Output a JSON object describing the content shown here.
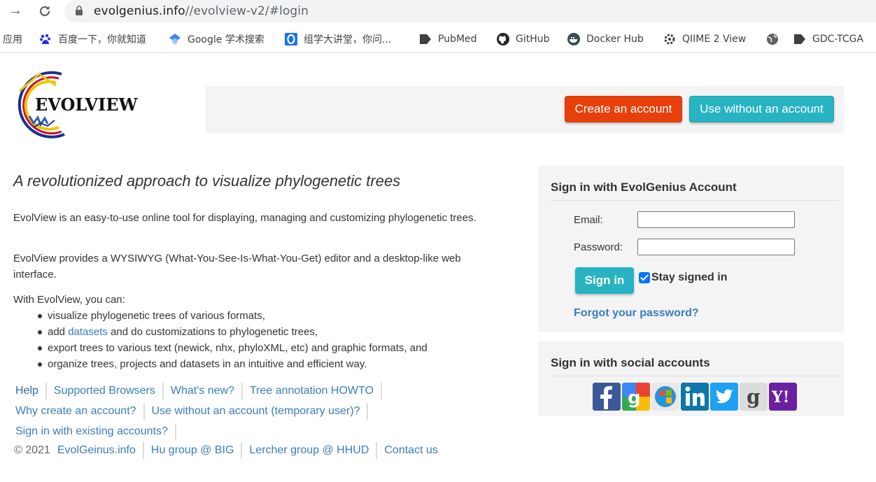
{
  "browser": {
    "url_host": "evolgenius.info",
    "url_path": "//evolview-v2/#login",
    "bookmarks": [
      {
        "label": "应用",
        "icon": "apps-icon"
      },
      {
        "label": "百度一下，你就知道",
        "icon": "baidu-icon"
      },
      {
        "label": "Google 学术搜索",
        "icon": "google-scholar-icon"
      },
      {
        "label": "组学大讲堂，你问...",
        "icon": "omics-icon"
      },
      {
        "label": "PubMed",
        "icon": "pubmed-icon"
      },
      {
        "label": "GitHub",
        "icon": "github-icon"
      },
      {
        "label": "Docker Hub",
        "icon": "docker-icon"
      },
      {
        "label": "QIIME 2 View",
        "icon": "qiime-icon"
      },
      {
        "label": "",
        "icon": "globe-icon"
      },
      {
        "label": "GDC-TCGA",
        "icon": "gdc-icon"
      }
    ]
  },
  "header": {
    "logo_text": "EVOLVIEW",
    "create_label": "Create an account",
    "without_label": "Use without an account"
  },
  "main": {
    "tagline": "A revolutionized approach to visualize phylogenetic trees",
    "para1": "EvolView is an easy-to-use online tool for displaying, managing and customizing phylogenetic trees.",
    "para2": "EvolView provides a WYSIWYG (What-You-See-Is-What-You-Get) editor and a desktop-like web interface.",
    "para3": "With EvolView, you can:",
    "list": [
      "visualize phylogenetic trees of various formats,",
      "add",
      "export trees to various text (newick, nhx, phyloXML, etc) and graphic formats, and",
      "organize trees, projects and datasets in an intuitive and efficient way."
    ],
    "list_link": "datasets",
    "list_after": " and do customizations to phylogenetic trees,"
  },
  "footer": {
    "row1": [
      "Help",
      "Supported Browsers",
      "What's new?",
      "Tree annotation HOWTO"
    ],
    "row2": [
      "Why create an account?",
      "Use without an account (temporary user)?"
    ],
    "row3": [
      "Sign in with existing accounts?"
    ],
    "copyright": "© 2021",
    "row4": [
      "EvolGeinus.info",
      "Hu group @ BIG",
      "Lercher group @ HHUD",
      "Contact us"
    ]
  },
  "signin": {
    "title": "Sign in with EvolGenius Account",
    "email_label": "Email:",
    "password_label": "Password:",
    "email_value": "",
    "password_value": "",
    "signin_label": "Sign in",
    "stay_label": "Stay signed in",
    "stay_checked": true,
    "forgot_label": "Forgot your password?"
  },
  "social": {
    "title": "Sign in with social accounts",
    "providers": [
      {
        "icon": "facebook-icon",
        "color": "#3b5998"
      },
      {
        "icon": "google-icon",
        "color": "#34a853"
      },
      {
        "icon": "windows-live-icon",
        "color": "#e8e8e8"
      },
      {
        "icon": "linkedin-icon",
        "color": "#0e76a8"
      },
      {
        "icon": "twitter-icon",
        "color": "#1da1f2"
      },
      {
        "icon": "goodreads-icon",
        "color": "#dcdcdc"
      },
      {
        "icon": "yahoo-icon",
        "color": "#6b1fa2"
      }
    ]
  }
}
